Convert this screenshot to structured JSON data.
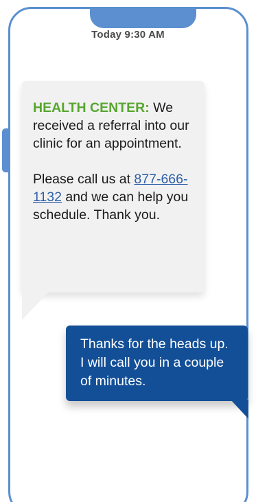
{
  "status": {
    "timestamp": "Today 9:30 AM"
  },
  "messages": {
    "incoming": {
      "sender": "HEALTH CENTER:",
      "intro": " We received a referral into our clinic for an appointment.",
      "call_prefix": "Please call us at ",
      "phone_number": "877-666-1132",
      "call_suffix": " and we can help you schedule. Thank you."
    },
    "outgoing": {
      "text": "Thanks for the heads up.  I will call you in a couple of minutes."
    }
  },
  "colors": {
    "frame": "#5b8fd0",
    "sender_label": "#57a62e",
    "incoming_bubble": "#f1f1f1",
    "outgoing_bubble": "#134f97",
    "link": "#2f5fa8"
  },
  "icons": {
    "notch": "phone-notch",
    "side_button": "phone-side-button"
  }
}
